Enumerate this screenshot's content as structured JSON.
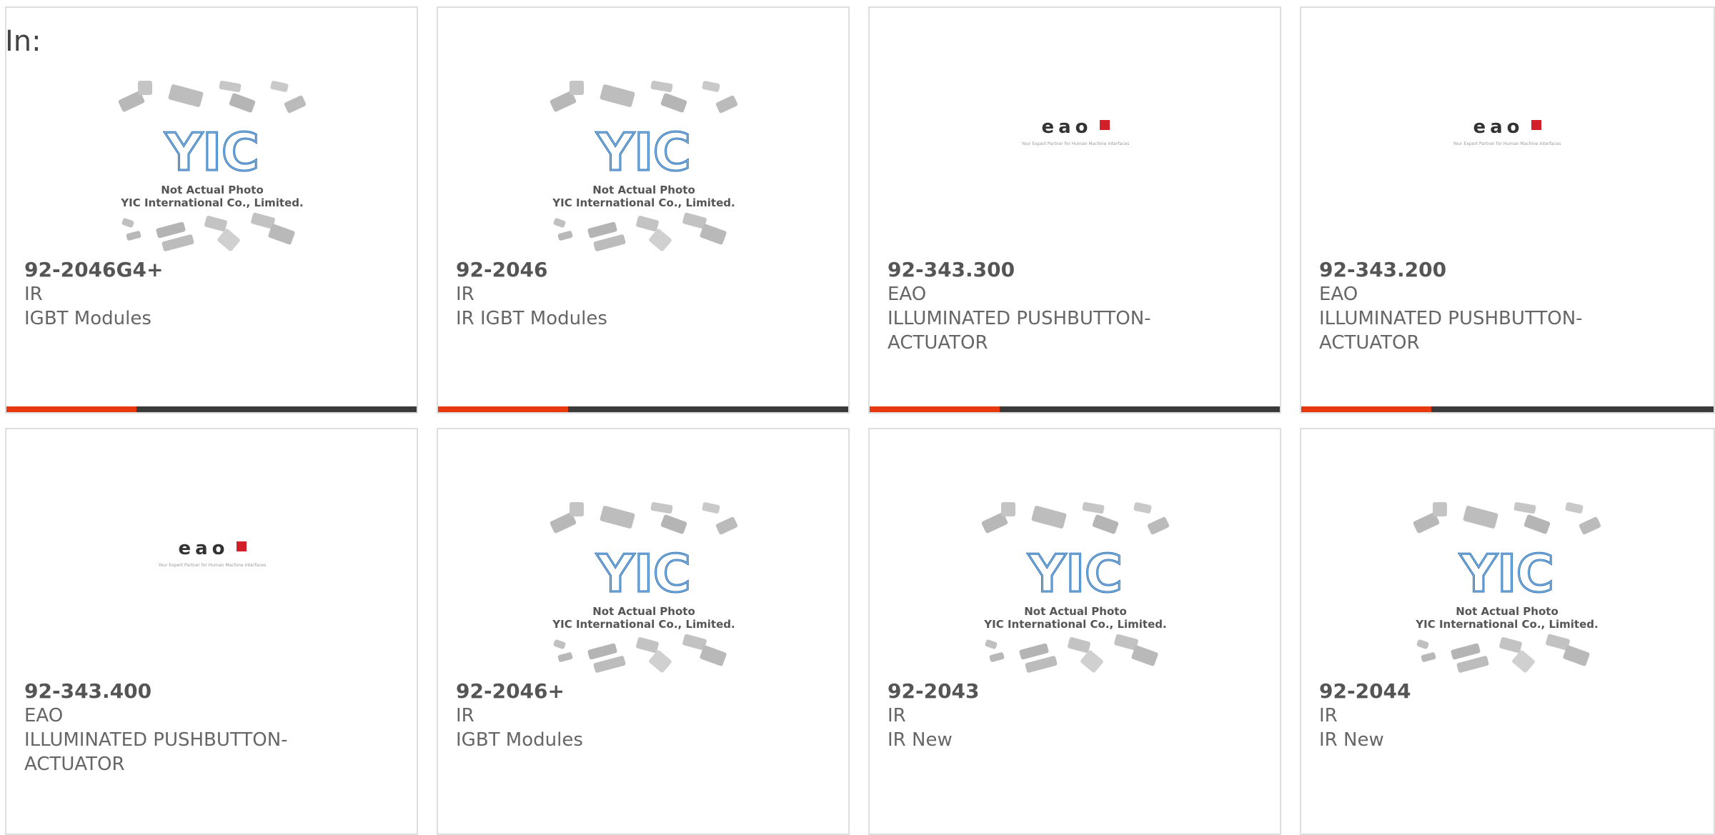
{
  "header": {
    "in_label": "In:"
  },
  "thumbnails": {
    "yic": {
      "line1": "Not Actual Photo",
      "line2": "YIC International Co., Limited.",
      "logo_text": "YIC"
    },
    "eao": {
      "logo_text": "eao",
      "tagline": "Your Expert Partner for Human Machine Interfaces"
    }
  },
  "colors": {
    "accent": "#e8380d",
    "bar": "#3a3a3a",
    "border": "#dedede"
  },
  "products": [
    {
      "part_number": "92-2046G4+",
      "manufacturer": "IR",
      "description": "IGBT Modules",
      "image": "yic"
    },
    {
      "part_number": "92-2046",
      "manufacturer": "IR",
      "description": "IR IGBT Modules",
      "image": "yic"
    },
    {
      "part_number": "92-343.300",
      "manufacturer": "EAO",
      "description": "ILLUMINATED PUSHBUTTON-ACTUATOR",
      "image": "eao"
    },
    {
      "part_number": "92-343.200",
      "manufacturer": "EAO",
      "description": "ILLUMINATED PUSHBUTTON-ACTUATOR",
      "image": "eao"
    },
    {
      "part_number": "92-343.400",
      "manufacturer": "EAO",
      "description": "ILLUMINATED PUSHBUTTON-ACTUATOR",
      "image": "eao"
    },
    {
      "part_number": "92-2046+",
      "manufacturer": "IR",
      "description": "IGBT Modules",
      "image": "yic"
    },
    {
      "part_number": "92-2043",
      "manufacturer": "IR",
      "description": "IR New",
      "image": "yic"
    },
    {
      "part_number": "92-2044",
      "manufacturer": "IR",
      "description": "IR New",
      "image": "yic"
    }
  ]
}
